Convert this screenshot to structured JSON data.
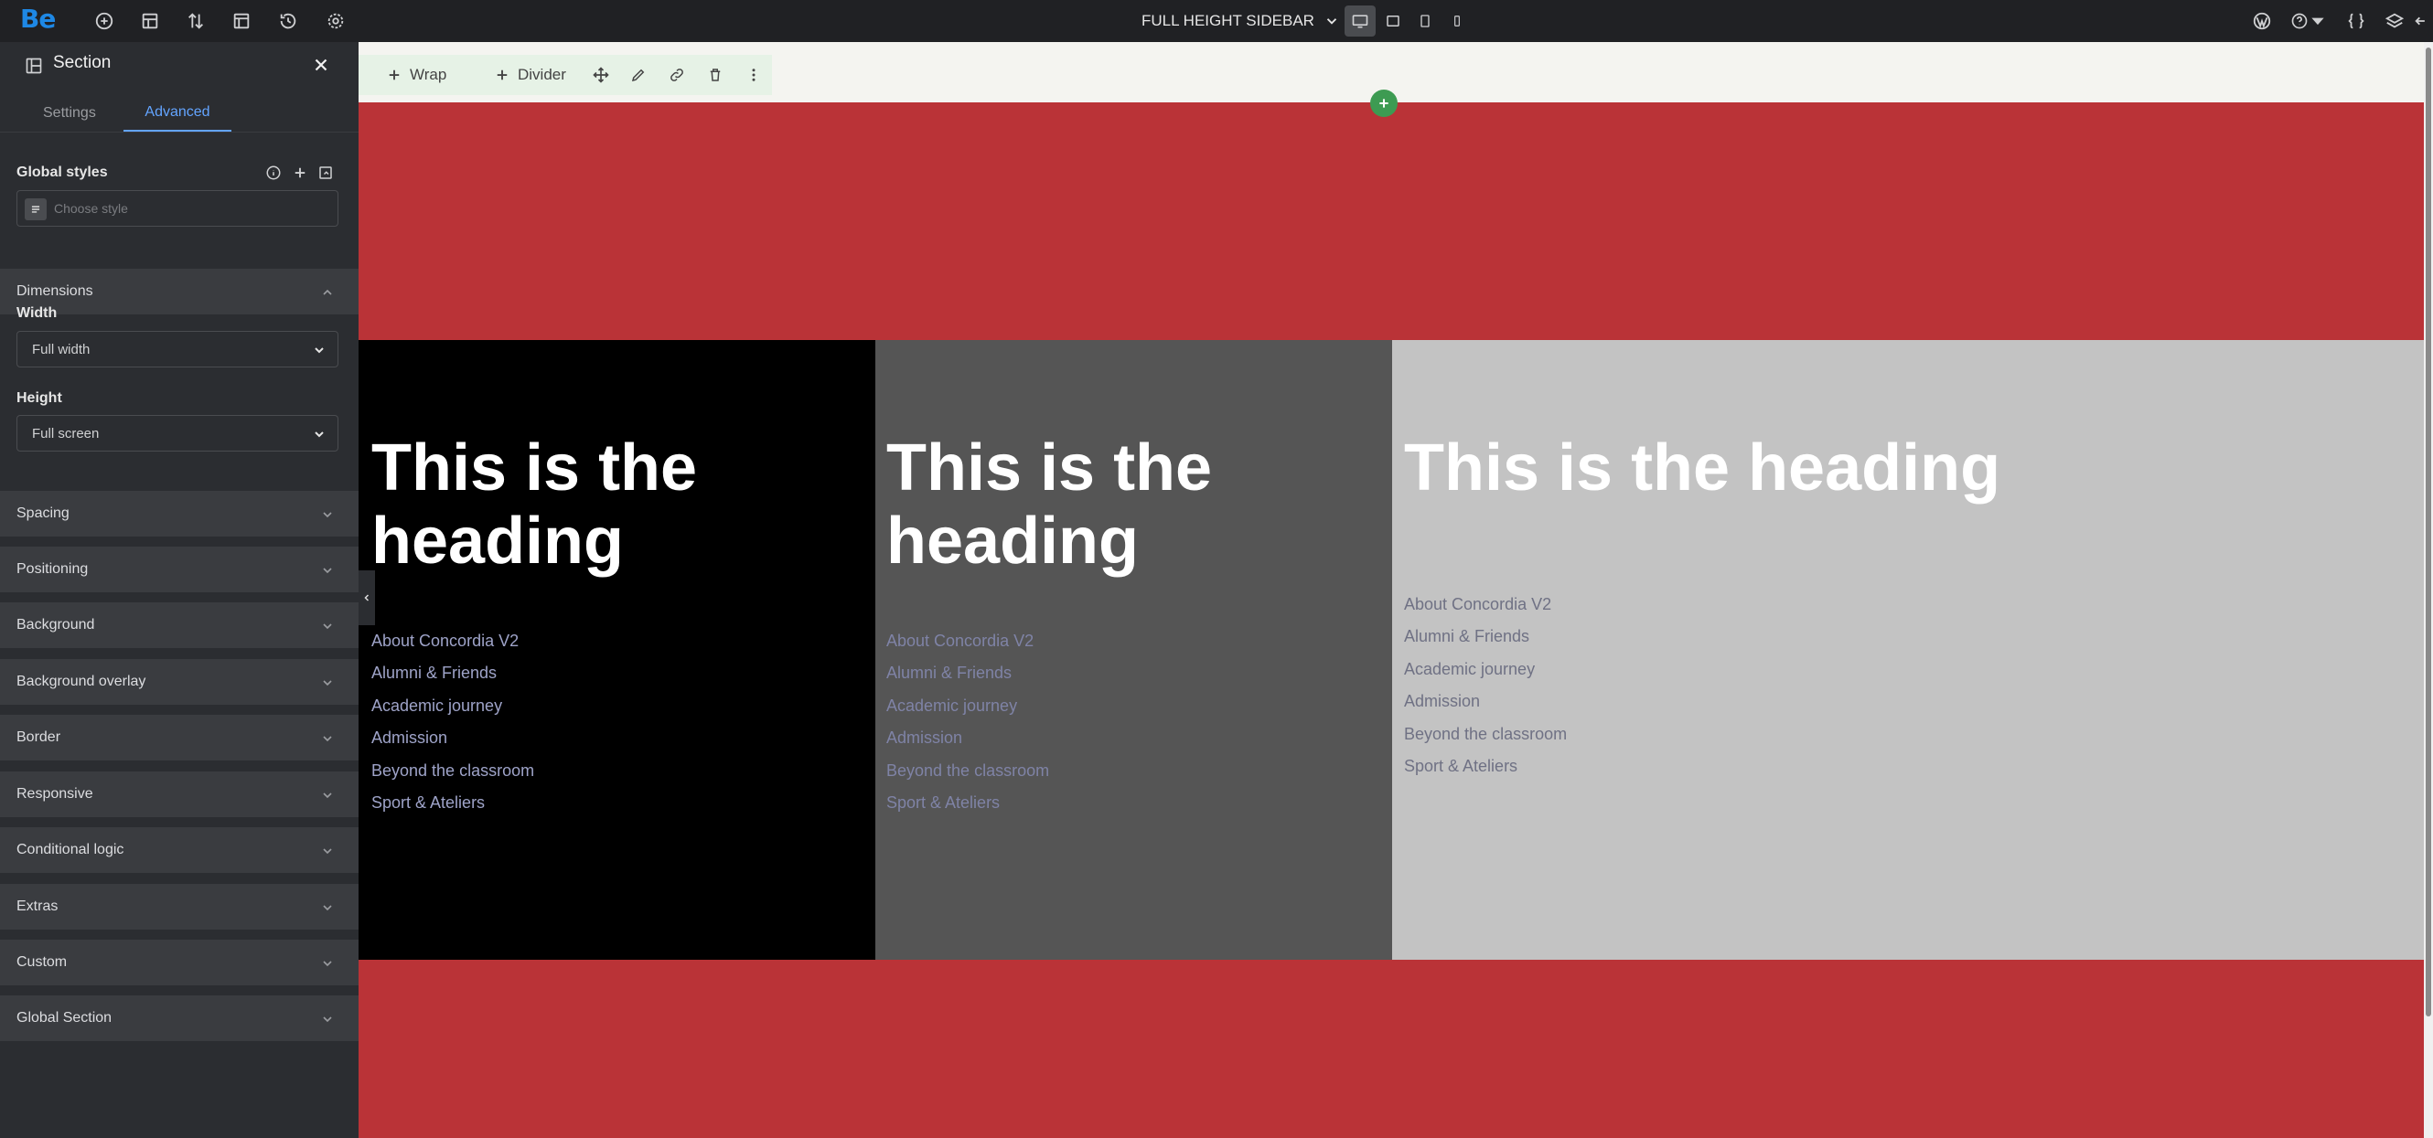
{
  "topbar": {
    "logo": "Be",
    "left_icons": [
      "add-icon",
      "layout-icon",
      "sort-icon",
      "template-icon",
      "history-icon",
      "settings-icon"
    ],
    "page_selector_label": "FULL HEIGHT SIDEBAR",
    "devices": [
      "desktop-icon",
      "laptop-icon",
      "tablet-icon",
      "mobile-icon"
    ],
    "active_device": "desktop-icon",
    "right_icons": [
      "wordpress-icon",
      "help-icon",
      "code-icon",
      "layers-icon",
      "exit-icon"
    ]
  },
  "sidebar": {
    "title": "Section",
    "tabs": [
      {
        "label": "Settings",
        "active": false
      },
      {
        "label": "Advanced",
        "active": true
      }
    ],
    "global_styles": {
      "label": "Global styles",
      "placeholder": "Choose style"
    },
    "dimensions": {
      "label": "Dimensions",
      "width_label": "Width",
      "width_value": "Full width",
      "height_label": "Height",
      "height_value": "Full screen"
    },
    "sections": [
      "Spacing",
      "Positioning",
      "Background",
      "Background overlay",
      "Border",
      "Responsive",
      "Conditional logic",
      "Extras",
      "Custom",
      "Global Section"
    ]
  },
  "canvas": {
    "toolbar": {
      "wrap_label": "Wrap",
      "divider_label": "Divider"
    },
    "colors": {
      "red": "#ba3337",
      "col1_bg": "#000000",
      "col2_bg": "#555555",
      "col3_bg": "#c3c3c3",
      "toolbar_bg": "#e6f2e6",
      "accent_green": "#3d9b52"
    },
    "columns": [
      {
        "heading": "This is the heading",
        "links": [
          "About Concordia V2",
          "Alumni & Friends",
          "Academic journey",
          "Admission",
          "Beyond the classroom",
          "Sport & Ateliers"
        ]
      },
      {
        "heading": "This is the heading",
        "links": [
          "About Concordia V2",
          "Alumni & Friends",
          "Academic journey",
          "Admission",
          "Beyond the classroom",
          "Sport & Ateliers"
        ]
      },
      {
        "heading": "This is the heading",
        "links": [
          "About Concordia V2",
          "Alumni & Friends",
          "Academic journey",
          "Admission",
          "Beyond the classroom",
          "Sport & Ateliers"
        ]
      }
    ]
  }
}
